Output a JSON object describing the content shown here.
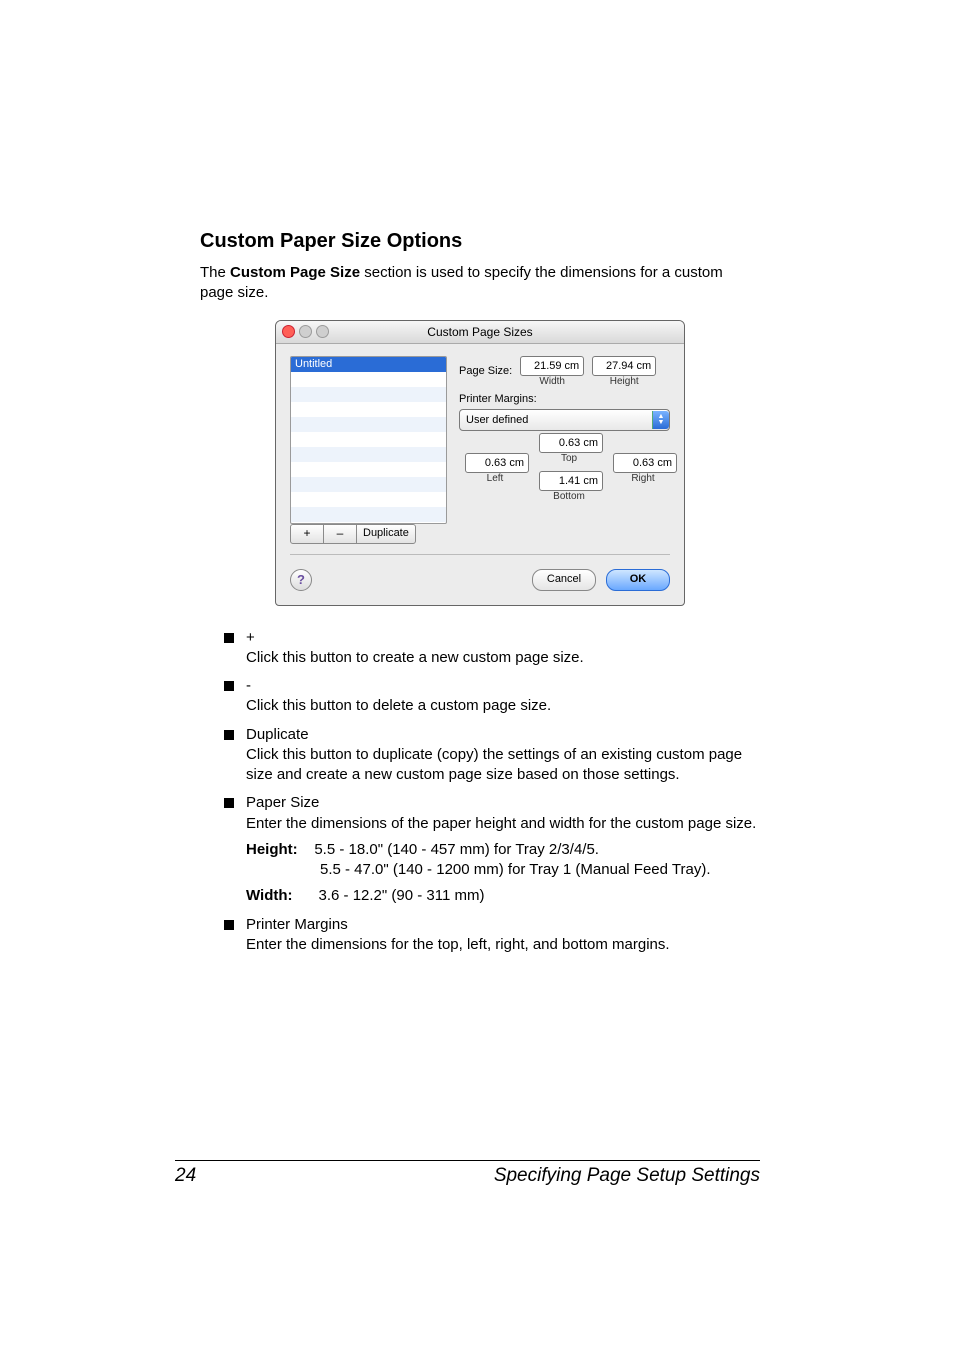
{
  "page": {
    "heading": "Custom Paper Size Options",
    "intro_pre": "The ",
    "intro_bold": "Custom Page Size",
    "intro_post": " section is used to specify the dimensions for a custom page size.",
    "number": "24",
    "footer": "Specifying Page Setup Settings"
  },
  "dialog": {
    "title": "Custom Page Sizes",
    "list_selected": "Untitled",
    "btn_plus": "+",
    "btn_minus": "–",
    "btn_dup": "Duplicate",
    "page_size_label": "Page Size:",
    "width_val": "21.59 cm",
    "width_lab": "Width",
    "height_val": "27.94 cm",
    "height_lab": "Height",
    "margins_label": "Printer Margins:",
    "popup_value": "User defined",
    "m_top": {
      "val": "0.63 cm",
      "lab": "Top"
    },
    "m_left": {
      "val": "0.63 cm",
      "lab": "Left"
    },
    "m_right": {
      "val": "0.63 cm",
      "lab": "Right"
    },
    "m_bottom": {
      "val": "1.41 cm",
      "lab": "Bottom"
    },
    "help": "?",
    "cancel": "Cancel",
    "ok": "OK"
  },
  "items": {
    "plus": {
      "h": "+",
      "b": "Click this button to create a new custom page size."
    },
    "minus": {
      "h": "-",
      "b": "Click this button to delete a custom page size."
    },
    "dup": {
      "h": "Duplicate",
      "b": "Click this button to duplicate (copy) the settings of an existing custom page size and create a new custom page size based on those settings."
    },
    "paper": {
      "h": "Paper Size",
      "b": "Enter the dimensions of the paper height and width for the custom page size."
    },
    "height": {
      "k": "Height:",
      "v1": "5.5 - 18.0\" (140 - 457 mm) for Tray 2/3/4/5.",
      "v2": "5.5 - 47.0\" (140 - 1200 mm) for Tray 1 (Manual Feed Tray)."
    },
    "width": {
      "k": "Width:",
      "v": "3.6 - 12.2\" (90 - 311 mm)"
    },
    "printer": {
      "h": "Printer Margins",
      "b": "Enter the dimensions for the top, left, right, and bottom margins."
    }
  }
}
